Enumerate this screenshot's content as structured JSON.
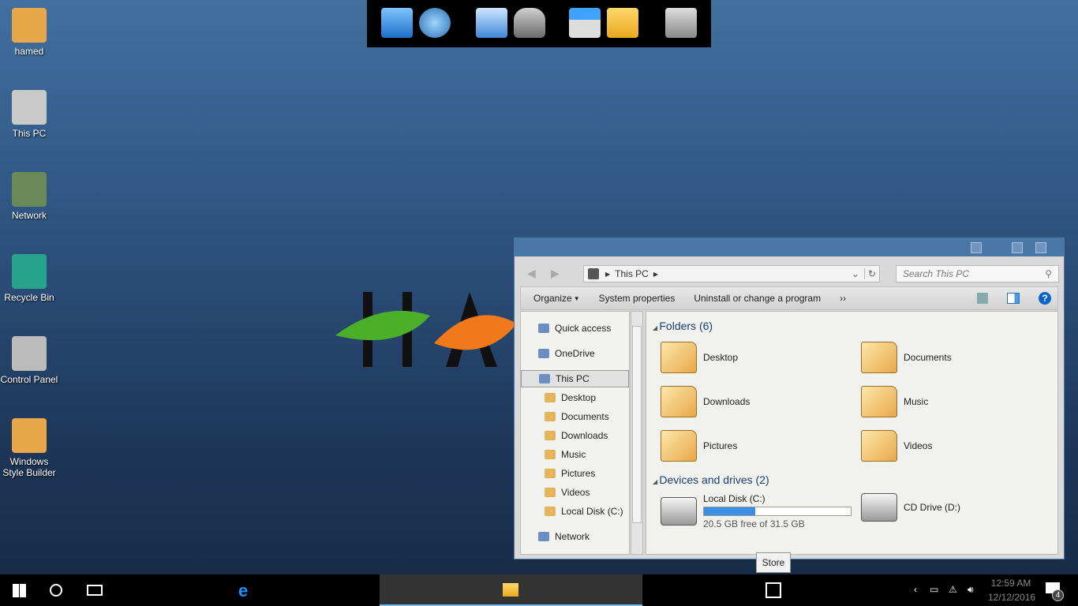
{
  "desktop": {
    "icons": [
      {
        "label": "hamed",
        "icon": "user-folder-icon"
      },
      {
        "label": "This PC",
        "icon": "computer-icon"
      },
      {
        "label": "Network",
        "icon": "network-icon"
      },
      {
        "label": "Recycle Bin",
        "icon": "recycle-bin-icon"
      },
      {
        "label": "Control Panel",
        "icon": "control-panel-icon"
      },
      {
        "label": "Windows Style Builder",
        "icon": "style-builder-icon"
      }
    ],
    "wallpaper_text": "HA"
  },
  "dock": {
    "items": [
      "computer-icon",
      "network-globe-icon",
      "control-panel-icon",
      "chess-pawn-icon",
      "windows-drive-icon",
      "file-explorer-icon",
      "recycle-bin-icon"
    ]
  },
  "explorer": {
    "address": {
      "crumb": "This PC",
      "search_placeholder": "Search This PC"
    },
    "toolbar": {
      "organize": "Organize",
      "system_properties": "System properties",
      "uninstall": "Uninstall or change a program",
      "more": "››"
    },
    "nav": [
      {
        "label": "Quick access",
        "level": 0
      },
      {
        "label": "OneDrive",
        "level": 0
      },
      {
        "label": "This PC",
        "level": 0,
        "selected": true
      },
      {
        "label": "Desktop",
        "level": 1
      },
      {
        "label": "Documents",
        "level": 1
      },
      {
        "label": "Downloads",
        "level": 1
      },
      {
        "label": "Music",
        "level": 1
      },
      {
        "label": "Pictures",
        "level": 1
      },
      {
        "label": "Videos",
        "level": 1
      },
      {
        "label": "Local Disk (C:)",
        "level": 1
      },
      {
        "label": "Network",
        "level": 0
      }
    ],
    "folders_header": "Folders (6)",
    "folders": [
      "Desktop",
      "Documents",
      "Downloads",
      "Music",
      "Pictures",
      "Videos"
    ],
    "devices_header": "Devices and drives (2)",
    "drives": [
      {
        "name": "Local Disk (C:)",
        "free": "20.5 GB free of 31.5 GB",
        "used_fraction": 0.35
      },
      {
        "name": "CD Drive (D:)"
      }
    ]
  },
  "tooltip": "Store",
  "taskbar": {
    "time": "12:59 AM",
    "date": "12/12/2016",
    "notifications": "4",
    "accent": "#3a8ee6"
  }
}
